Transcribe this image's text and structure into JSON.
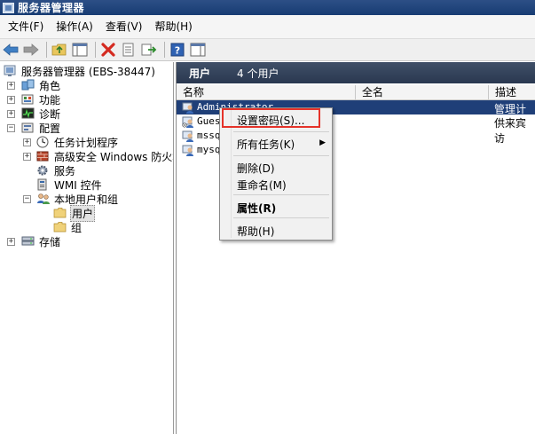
{
  "window": {
    "title": "服务器管理器"
  },
  "menubar": {
    "items": [
      "文件(F)",
      "操作(A)",
      "查看(V)",
      "帮助(H)"
    ]
  },
  "toolbar": {
    "buttons": [
      "back-icon",
      "forward-icon",
      "up-folder-icon",
      "show-hide-tree-icon",
      "delete-icon",
      "properties-icon",
      "export-icon",
      "help-icon",
      "action-pane-icon"
    ]
  },
  "tree": {
    "root": "服务器管理器 (EBS-38447)",
    "roles": "角色",
    "features": "功能",
    "diagnostics": "诊断",
    "configuration": "配置",
    "task_scheduler": "任务计划程序",
    "firewall": "高级安全 Windows 防火墙",
    "services": "服务",
    "wmi": "WMI 控件",
    "local_users_groups": "本地用户和组",
    "users": "用户",
    "groups": "组",
    "storage": "存储"
  },
  "right": {
    "header_title": "用户",
    "header_count": "4 个用户",
    "columns": [
      "名称",
      "全名",
      "描述"
    ],
    "users": [
      {
        "name": "Administrator",
        "desc": "管理计算"
      },
      {
        "name": "Guest",
        "desc": "供来宾访"
      },
      {
        "name": "mssql",
        "desc": ""
      },
      {
        "name": "mysql",
        "desc": ""
      }
    ]
  },
  "context_menu": {
    "set_password": "设置密码(S)...",
    "all_tasks": "所有任务(K)",
    "delete": "删除(D)",
    "rename": "重命名(M)",
    "properties": "属性(R)",
    "help": "帮助(H)"
  },
  "colors": {
    "title_bar": "#173c73",
    "header_bar": "#2a3850",
    "selection": "#1f3f78",
    "highlight_box": "#e5332a"
  }
}
